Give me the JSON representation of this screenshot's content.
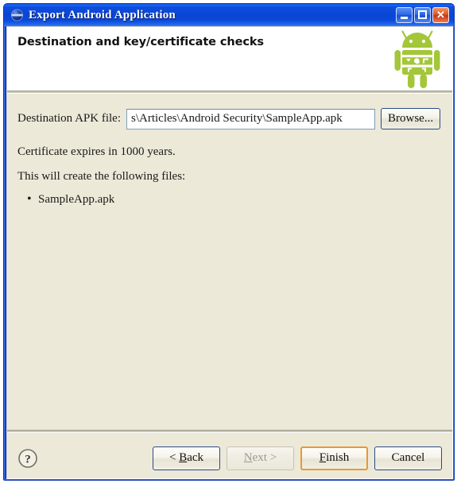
{
  "window": {
    "title": "Export Android Application",
    "icon": "eclipse-wizard-icon",
    "controls": {
      "minimize": "minimize-button",
      "maximize": "maximize-button",
      "close_glyph": "✕"
    },
    "colors": {
      "titlebar_blue": "#0a46d6",
      "frame_blue": "#0a3fd4",
      "body_beige": "#ece9d8",
      "android_green": "#a4c639",
      "default_button_focus": "#e79a2e",
      "close_button_red": "#e05a28"
    }
  },
  "header": {
    "title": "Destination and key/certificate checks",
    "logo": "android-robot-logo"
  },
  "form": {
    "destination_label": "Destination APK file:",
    "destination_value": "s\\Articles\\Android Security\\SampleApp.apk",
    "destination_placeholder": "",
    "browse_label": "Browse..."
  },
  "messages": {
    "certificate_note": "Certificate expires in 1000 years.",
    "files_intro": "This will create the following files:",
    "files": [
      "SampleApp.apk"
    ]
  },
  "footer": {
    "help": "help-button",
    "buttons": [
      {
        "name": "back",
        "pre": "< ",
        "accel": "B",
        "post": "ack",
        "state": "enabled"
      },
      {
        "name": "next",
        "pre": "",
        "accel": "N",
        "post": "ext >",
        "state": "disabled"
      },
      {
        "name": "finish",
        "pre": "",
        "accel": "F",
        "post": "inish",
        "state": "default"
      },
      {
        "name": "cancel",
        "pre": "",
        "accel": "",
        "post": "Cancel",
        "state": "enabled"
      }
    ],
    "labels": {
      "back": "< Back",
      "next": "Next >",
      "finish": "Finish",
      "cancel": "Cancel"
    }
  }
}
